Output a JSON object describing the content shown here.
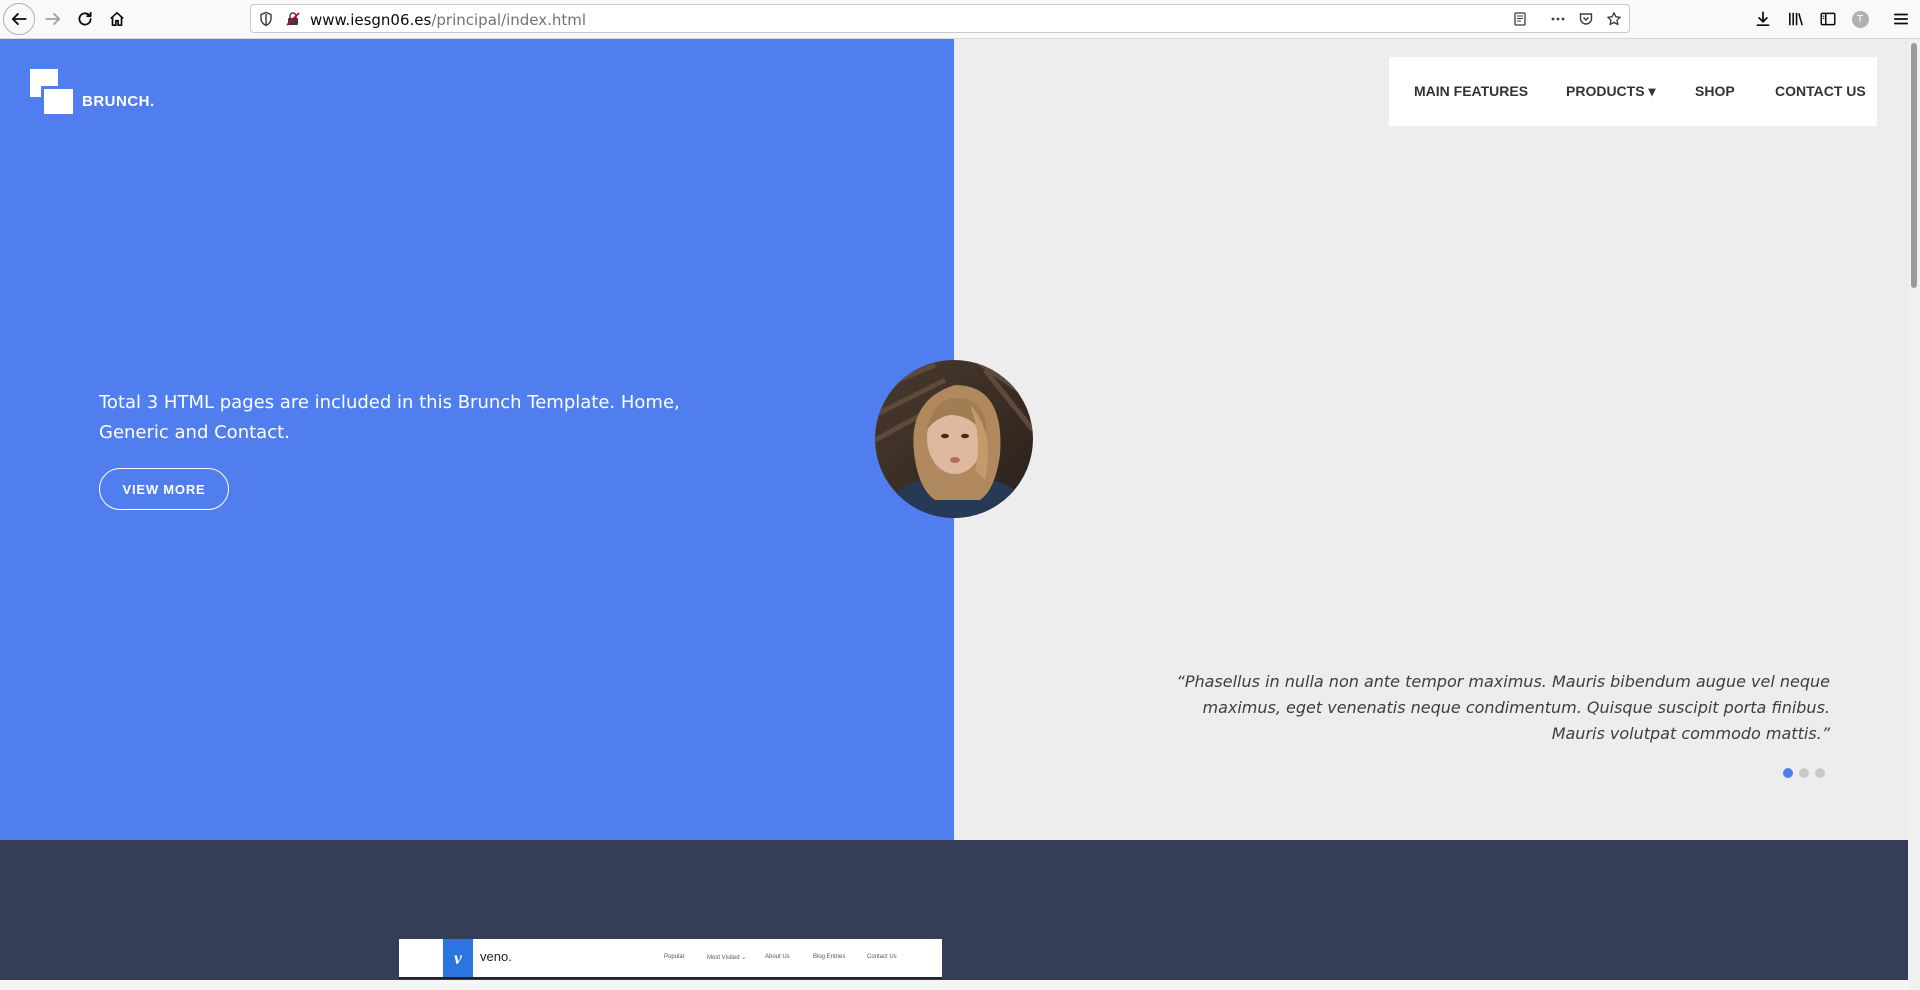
{
  "browser": {
    "url_host": "www.iesgn06.es",
    "url_path": "/principal/index.html",
    "profile_initial": "T"
  },
  "site": {
    "brand": "BRUNCH.",
    "nav": [
      "MAIN FEATURES",
      "PRODUCTS ▾",
      "SHOP",
      "CONTACT US"
    ],
    "hero_text": "Total 3 HTML pages are included in this Brunch Template. Home, Generic and Contact.",
    "hero_button": "VIEW MORE",
    "quote": "“Phasellus in nulla non ante tempor maximus. Mauris bibendum augue vel neque maximus, eget venenatis neque condimentum. Quisque suscipit porta finibus. Mauris volutpat commodo mattis.”",
    "slider_dots": 3,
    "slider_active": 0
  },
  "preview": {
    "logo_letter": "v",
    "name": "veno.",
    "nav": [
      "Popular",
      "Most Visited ⌄",
      "About Us",
      "Blog Entries",
      "Contact Us"
    ]
  },
  "colors": {
    "accent": "#517eef",
    "dark_band": "#353e57",
    "hero_right": "#ededed"
  }
}
